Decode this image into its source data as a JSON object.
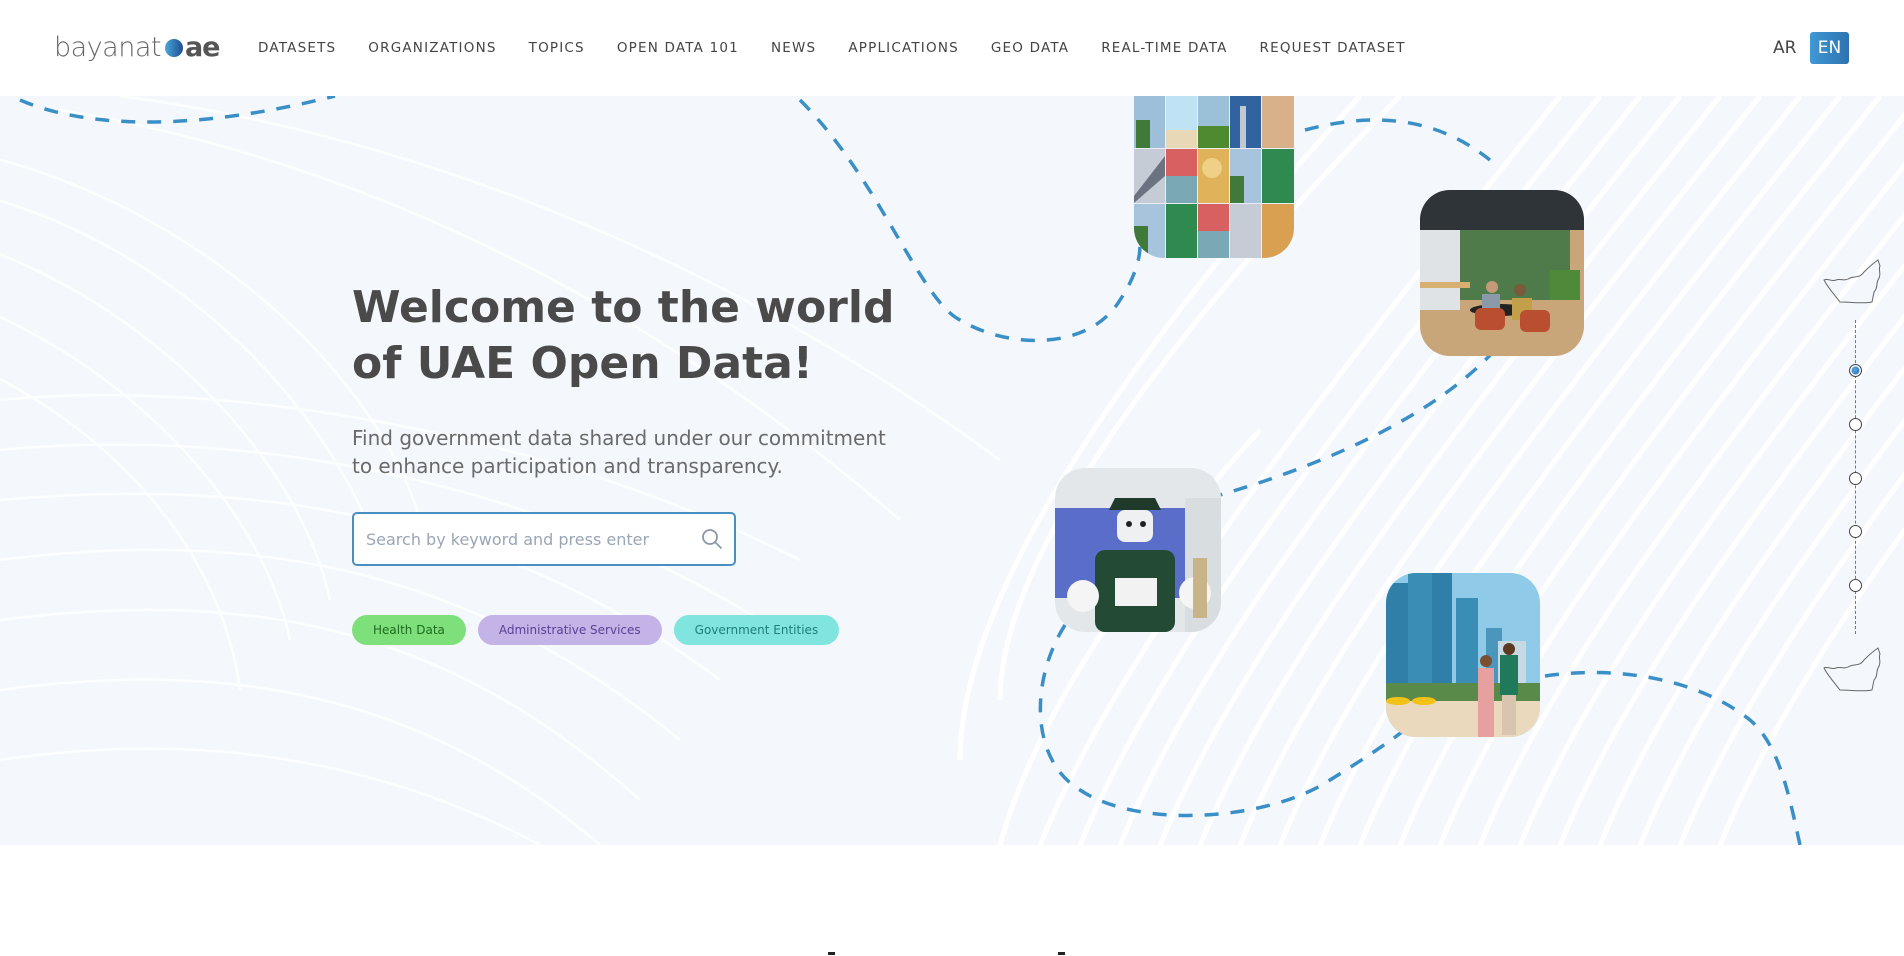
{
  "header": {
    "logo": {
      "text": "bayanat",
      "suffix": "ae"
    },
    "nav": [
      {
        "label": "DATASETS"
      },
      {
        "label": "ORGANIZATIONS"
      },
      {
        "label": "TOPICS"
      },
      {
        "label": "OPEN DATA 101"
      },
      {
        "label": "NEWS"
      },
      {
        "label": "APPLICATIONS"
      },
      {
        "label": "GEO DATA"
      },
      {
        "label": "REAL-TIME DATA"
      },
      {
        "label": "REQUEST DATASET"
      }
    ],
    "languages": {
      "ar": "AR",
      "en": "EN",
      "active": "EN"
    }
  },
  "hero": {
    "title": "Welcome to the world of UAE Open Data!",
    "subtitle": "Find government data shared under our commitment to enhance participation and transparency.",
    "search": {
      "placeholder": "Search by keyword and press enter",
      "value": "",
      "icon": "search-icon"
    },
    "chips": [
      {
        "label": "Health Data",
        "bg": "#7ee07a",
        "fg": "#1f6b1f"
      },
      {
        "label": "Administrative Services",
        "bg": "#c4b3e6",
        "fg": "#5b4296"
      },
      {
        "label": "Government Entities",
        "bg": "#7fe5de",
        "fg": "#1f7f78"
      }
    ],
    "photos": [
      {
        "name": "photo-collage",
        "description": "Collage grid of UAE photos"
      },
      {
        "name": "photo-coworking",
        "description": "Two men working at a table in a modern office"
      },
      {
        "name": "photo-robocop",
        "description": "Police robot at exhibition"
      },
      {
        "name": "photo-beach",
        "description": "Couple walking on beach with skyline"
      }
    ]
  },
  "slider": {
    "total_steps": 5,
    "active_step": 1
  },
  "colors": {
    "accent": "#3f8fc6",
    "hero_bg": "#f4f8fc",
    "title": "#4a4a4a"
  }
}
